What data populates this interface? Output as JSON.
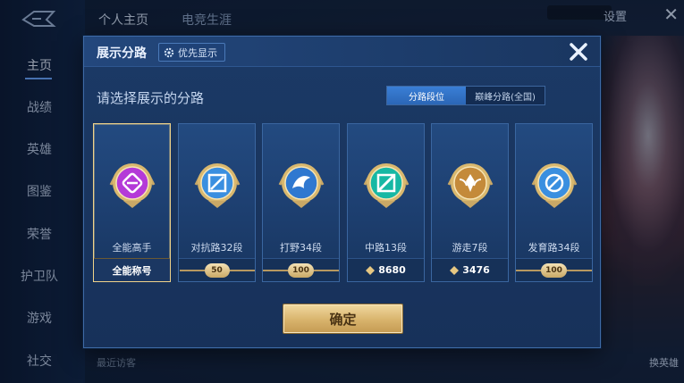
{
  "background": {
    "nav": [
      {
        "label": "主页",
        "active": true
      },
      {
        "label": "战绩",
        "active": false
      },
      {
        "label": "英雄",
        "active": false
      },
      {
        "label": "图鉴",
        "active": false
      },
      {
        "label": "荣誉",
        "active": false
      },
      {
        "label": "护卫队",
        "active": false
      },
      {
        "label": "游戏",
        "active": false
      },
      {
        "label": "社交",
        "active": false
      }
    ],
    "top_tabs": [
      "个人主页",
      "电竞生涯"
    ],
    "settings_label": "设置",
    "recent_visitors": "最近访客",
    "switch_hero": "换英雄"
  },
  "modal": {
    "title": "展示分路",
    "priority_button": "优先显示",
    "close_icon": "close-icon",
    "prompt": "请选择展示的分路",
    "toggle": [
      {
        "label": "分路段位",
        "active": true
      },
      {
        "label": "巅峰分路(全国)",
        "active": false
      }
    ],
    "cards": [
      {
        "label": "全能高手",
        "footer_text": "全能称号",
        "footer_type": "text",
        "selected": true,
        "emblem_color": "#b43ad8",
        "icon": "allround-icon"
      },
      {
        "label": "对抗路32段",
        "footer_text": "50",
        "footer_type": "badge",
        "selected": false,
        "emblem_color": "#3a8fe0",
        "icon": "clash-lane-icon"
      },
      {
        "label": "打野34段",
        "footer_text": "100",
        "footer_type": "badge",
        "selected": false,
        "emblem_color": "#2f78d0",
        "icon": "jungle-icon"
      },
      {
        "label": "中路13段",
        "footer_text": "8680",
        "footer_type": "points",
        "selected": false,
        "emblem_color": "#17b8a4",
        "icon": "mid-lane-icon"
      },
      {
        "label": "游走7段",
        "footer_text": "3476",
        "footer_type": "points",
        "selected": false,
        "emblem_color": "#c48a3a",
        "icon": "roam-icon"
      },
      {
        "label": "发育路34段",
        "footer_text": "100",
        "footer_type": "badge",
        "selected": false,
        "emblem_color": "#3a8fe0",
        "icon": "farm-lane-icon"
      }
    ],
    "confirm_label": "确定"
  },
  "colors": {
    "accent_gold": "#e6c782",
    "modal_bg": "#1b3a67",
    "toggle_active": "#3a7fd6"
  }
}
